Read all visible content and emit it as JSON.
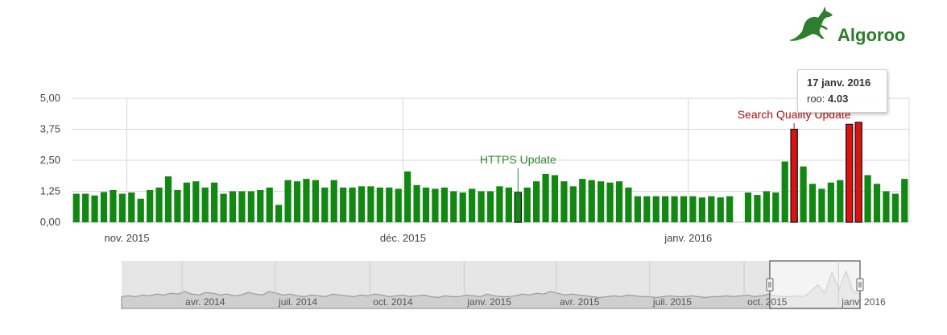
{
  "brand": {
    "name": "Algoroo",
    "logo_icon": "kangaroo-icon"
  },
  "tooltip": {
    "date": "17 janv. 2016",
    "series": "roo",
    "separator": ": ",
    "value": "4.03"
  },
  "colors": {
    "bar": "#118811",
    "bar_highlight": "#dd1111",
    "grid": "#d8d8d8",
    "axis_text": "#444444",
    "navigator_fill": "#e6e6e6",
    "navigator_line": "#999999",
    "annotation_green": "#2f8a2f",
    "annotation_red": "#b01010"
  },
  "chart_data": [
    {
      "type": "bar",
      "series": [
        {
          "name": "roo"
        }
      ],
      "y_ticks": [
        "0,00",
        "1,25",
        "2,50",
        "3,75",
        "5,00"
      ],
      "ylim": [
        0,
        5
      ],
      "grid": true,
      "x_tick_labels": [
        "nov. 2015",
        "déc. 2015",
        "janv. 2016"
      ],
      "date_range": [
        "2015-10-26",
        "2016-01-22"
      ],
      "annotations": [
        {
          "text": "HTTPS Update",
          "date": "2015-12-13",
          "color": "green"
        },
        {
          "text": "Search Quality Update",
          "date": "2016-01-12",
          "color": "red"
        }
      ],
      "values": [
        1.15,
        1.15,
        1.08,
        1.22,
        1.3,
        1.15,
        1.2,
        0.95,
        1.3,
        1.4,
        1.85,
        1.3,
        1.6,
        1.65,
        1.4,
        1.6,
        1.15,
        1.25,
        1.25,
        1.25,
        1.3,
        1.4,
        0.7,
        1.7,
        1.65,
        1.75,
        1.7,
        1.4,
        1.7,
        1.4,
        1.4,
        1.45,
        1.45,
        1.4,
        1.4,
        1.35,
        2.05,
        1.5,
        1.4,
        1.35,
        1.4,
        1.25,
        1.2,
        1.35,
        1.25,
        1.25,
        1.45,
        1.4,
        1.2,
        1.4,
        1.65,
        1.95,
        1.9,
        1.65,
        1.45,
        1.75,
        1.7,
        1.65,
        1.6,
        1.65,
        1.4,
        1.05,
        1.05,
        1.05,
        1.05,
        1.05,
        1.05,
        1.05,
        1.0,
        1.05,
        1.0,
        1.05,
        null,
        1.2,
        1.1,
        1.25,
        1.2,
        2.45,
        3.75,
        2.25,
        1.55,
        1.35,
        1.6,
        1.7,
        3.95,
        4.03,
        1.9,
        1.55,
        1.25,
        1.15,
        1.75
      ],
      "highlighted_indices": [
        78,
        84,
        85
      ]
    },
    {
      "type": "area",
      "role": "navigator",
      "x_tick_labels": [
        "avr. 2014",
        "juil. 2014",
        "oct. 2014",
        "janv. 2015",
        "avr. 2015",
        "juil. 2015",
        "oct. 2015",
        "janv. 2016"
      ],
      "date_range": [
        "2014-02-01",
        "2016-01-22"
      ],
      "selected_range": [
        "2015-10-26",
        "2016-01-22"
      ],
      "values": [
        1.0,
        1.1,
        1.0,
        1.2,
        1.1,
        1.3,
        1.2,
        1.4,
        1.3,
        1.6,
        1.3,
        1.2,
        1.5,
        1.4,
        1.2,
        1.3,
        1.1,
        1.2,
        1.5,
        1.3,
        1.2,
        1.6,
        1.4,
        1.2,
        1.3,
        1.1,
        1.0,
        1.2,
        1.1,
        1.0,
        1.3,
        1.2,
        1.1,
        1.0,
        1.2,
        1.1,
        1.3,
        1.2,
        1.0,
        1.1,
        1.2,
        1.0,
        1.1,
        1.2,
        1.0,
        0.9,
        1.1,
        1.0,
        1.0,
        1.2,
        1.1,
        1.0,
        1.3,
        1.1,
        1.0,
        1.0,
        1.1,
        1.3,
        1.2,
        1.4,
        1.3,
        1.6,
        1.4,
        1.2,
        1.3,
        1.2,
        1.1,
        1.0,
        0.9,
        1.0,
        1.1,
        1.0,
        1.2,
        1.1,
        1.0,
        1.0,
        0.9,
        1.0,
        1.1,
        1.0,
        1.0,
        1.1,
        1.0,
        0.9,
        1.0,
        1.0,
        1.1,
        1.0,
        1.1,
        1.2,
        1.0,
        1.1,
        1.3,
        1.1,
        1.0,
        1.0,
        1.1,
        1.0,
        1.6,
        2.4,
        1.4,
        3.8,
        1.8,
        4.0,
        1.6,
        1.3
      ]
    }
  ]
}
